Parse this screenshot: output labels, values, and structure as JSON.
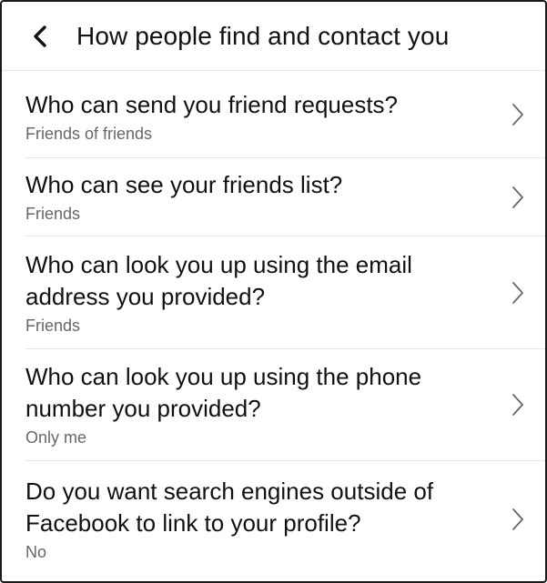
{
  "header": {
    "back_icon": "chevron-left-icon",
    "title": "How people find and contact you"
  },
  "settings": [
    {
      "question": "Who can send you friend requests?",
      "value": "Friends of friends"
    },
    {
      "question": "Who can see your friends list?",
      "value": "Friends"
    },
    {
      "question": "Who can look you up using the email address you provided?",
      "value": "Friends"
    },
    {
      "question": "Who can look you up using the phone number you provided?",
      "value": "Only me"
    },
    {
      "question": "Do you want search engines outside of Facebook to link to your profile?",
      "value": "No"
    }
  ],
  "row_chevron_icon": "chevron-right-icon",
  "colors": {
    "text_primary": "#111111",
    "text_secondary": "#65676b",
    "divider": "#e4e6eb"
  }
}
